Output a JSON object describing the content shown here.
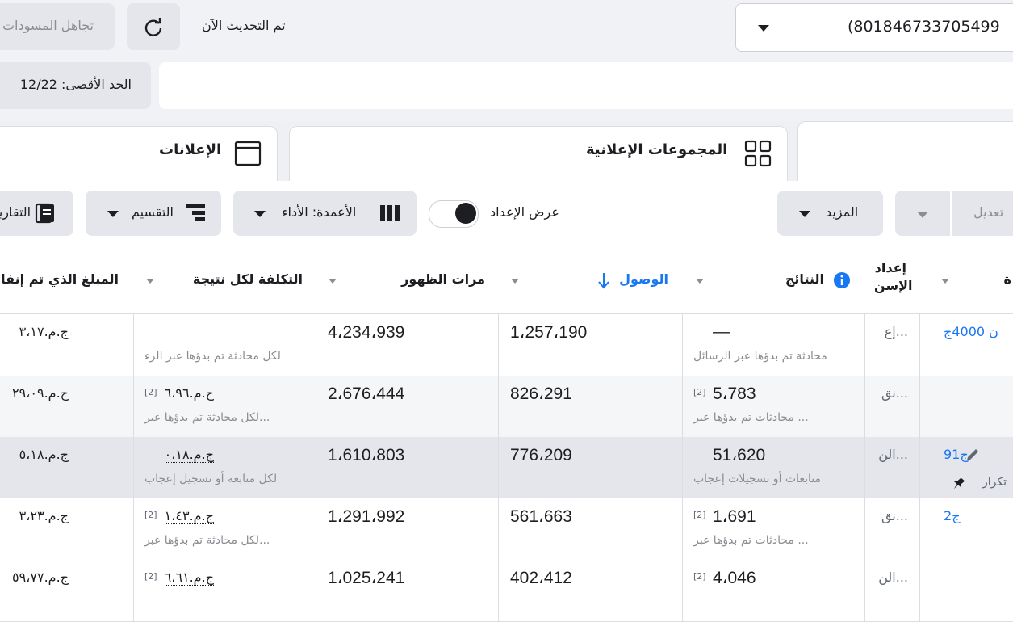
{
  "top": {
    "account_select": "(801846733705499",
    "refresh_status": "تم التحديث الآن",
    "ignore_drafts": "تجاهل المسودات",
    "max_label": "الحد الأقصى: 12/22"
  },
  "tabs": {
    "ad_sets": "المجموعات الإعلانية",
    "ads": "الإعلانات"
  },
  "toolbar": {
    "edit": "تعديل",
    "more": "المزيد",
    "show_setup": "عرض الإعداد",
    "columns": "الأعمدة: الأداء",
    "breakdown": "التقسيم",
    "reports": "التقارير"
  },
  "headers": {
    "name": "ة",
    "setup": "إعداد الإسن",
    "results": "النتائج",
    "reach": "الوصول",
    "impressions": "مرات الظهور",
    "cost_per_result": "التكلفة لكل نتيجة",
    "amount_spent": "المبلغ الذي تم إنفا"
  },
  "rows": [
    {
      "name": "ن 4000ج",
      "setup": "إع...",
      "results": "—",
      "results_sub": "محادثة تم بدؤها عبر الرسائل",
      "results_fn": "",
      "reach": "1،257،190",
      "impressions": "4،234،939",
      "cost": "",
      "cost_sub": "لكل محادثة تم بدؤها عبر الرء",
      "cost_fn": "",
      "spent": "ج.م.٣،١٧"
    },
    {
      "name": "",
      "setup": "نق...",
      "results": "5،783",
      "results_sub": "محادثات تم بدؤها عبر ...",
      "results_fn": "[2]",
      "reach": "826،291",
      "impressions": "2،676،444",
      "cost": "ج.م.٦،٩٦",
      "cost_sub": "لكل محادثة تم بدؤها عبر...",
      "cost_fn": "[2]",
      "spent": "ج.م.٢٩،٠٩"
    },
    {
      "name": "91ج",
      "name_sub": "تكرار",
      "setup": "الن...",
      "results": "51،620",
      "results_sub": "متابعات أو تسجيلات إعجاب",
      "results_fn": "",
      "reach": "776،209",
      "impressions": "1،610،803",
      "cost": "ج.م.٠،١٨",
      "cost_sub": "لكل متابعة أو تسجيل إعجاب",
      "cost_fn": "",
      "spent": "ج.م.٥،١٨"
    },
    {
      "name": "2ج",
      "setup": "نق...",
      "results": "1،691",
      "results_sub": "محادثات تم بدؤها عبر ...",
      "results_fn": "[2]",
      "reach": "561،663",
      "impressions": "1،291،992",
      "cost": "ج.م.١،٤٣",
      "cost_sub": "لكل محادثة تم بدؤها عبر...",
      "cost_fn": "[2]",
      "spent": "ج.م.٣،٢٣"
    },
    {
      "name": "",
      "setup": "الن...",
      "results": "4،046",
      "results_sub": "",
      "results_fn": "[2]",
      "reach": "402،412",
      "impressions": "1،025،241",
      "cost": "ج.م.٦،٦١",
      "cost_sub": "",
      "cost_fn": "[2]",
      "spent": "ج.م.٥٩،٧٧"
    }
  ]
}
